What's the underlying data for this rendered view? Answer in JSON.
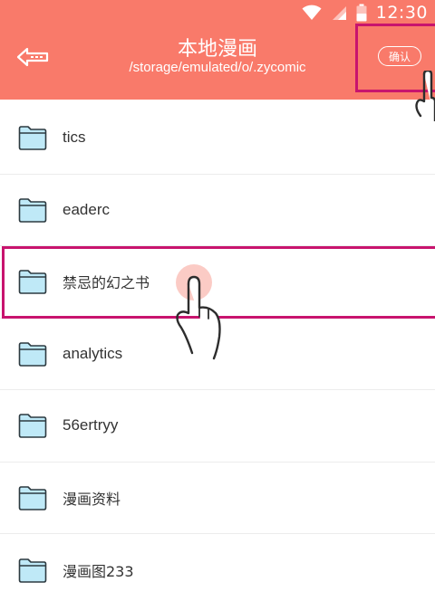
{
  "status_bar": {
    "time": "12:30",
    "icons": [
      "wifi-icon",
      "signal-icon",
      "battery-icon"
    ]
  },
  "header": {
    "title": "本地漫画",
    "path": "/storage/emulated/o/.zycomic",
    "confirm_label": "确认",
    "back_icon": "back-arrow-icon",
    "background_color": "#f97a6a"
  },
  "folders": [
    {
      "name": "tics"
    },
    {
      "name": "eaderc"
    },
    {
      "name": "禁忌的幻之书"
    },
    {
      "name": "analytics"
    },
    {
      "name": "56ertryy"
    },
    {
      "name": "漫画资料"
    },
    {
      "name": "漫画图233"
    }
  ],
  "annotations": {
    "highlight_color": "#c8146e",
    "hand_icon": "pointing-hand-icon"
  }
}
